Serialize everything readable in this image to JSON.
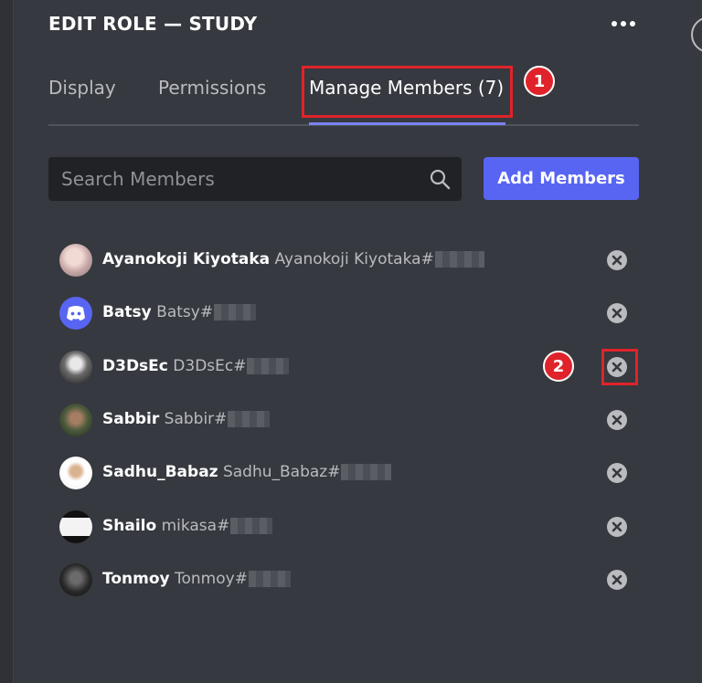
{
  "header": {
    "title": "EDIT ROLE — STUDY"
  },
  "tabs": [
    {
      "label": "Display"
    },
    {
      "label": "Permissions"
    },
    {
      "label": "Manage Members (7)",
      "active": true
    }
  ],
  "annotations": {
    "step1": "1",
    "step2": "2"
  },
  "search": {
    "placeholder": "Search Members"
  },
  "add_button": {
    "label": "Add Members"
  },
  "members": [
    {
      "display": "Ayanokoji Kiyotaka",
      "tag": "Ayanokoji Kiyotaka#"
    },
    {
      "display": "Batsy",
      "tag": "Batsy#"
    },
    {
      "display": "D3DsEc",
      "tag": "D3DsEc#"
    },
    {
      "display": "Sabbir",
      "tag": "Sabbir#"
    },
    {
      "display": "Sadhu_Babaz",
      "tag": "Sadhu_Babaz#"
    },
    {
      "display": "Shailo",
      "tag": "mikasa#"
    },
    {
      "display": "Tonmoy",
      "tag": "Tonmoy#"
    }
  ],
  "colors": {
    "accent": "#5865f2",
    "annotation": "#e0232a",
    "background": "#36393f"
  }
}
